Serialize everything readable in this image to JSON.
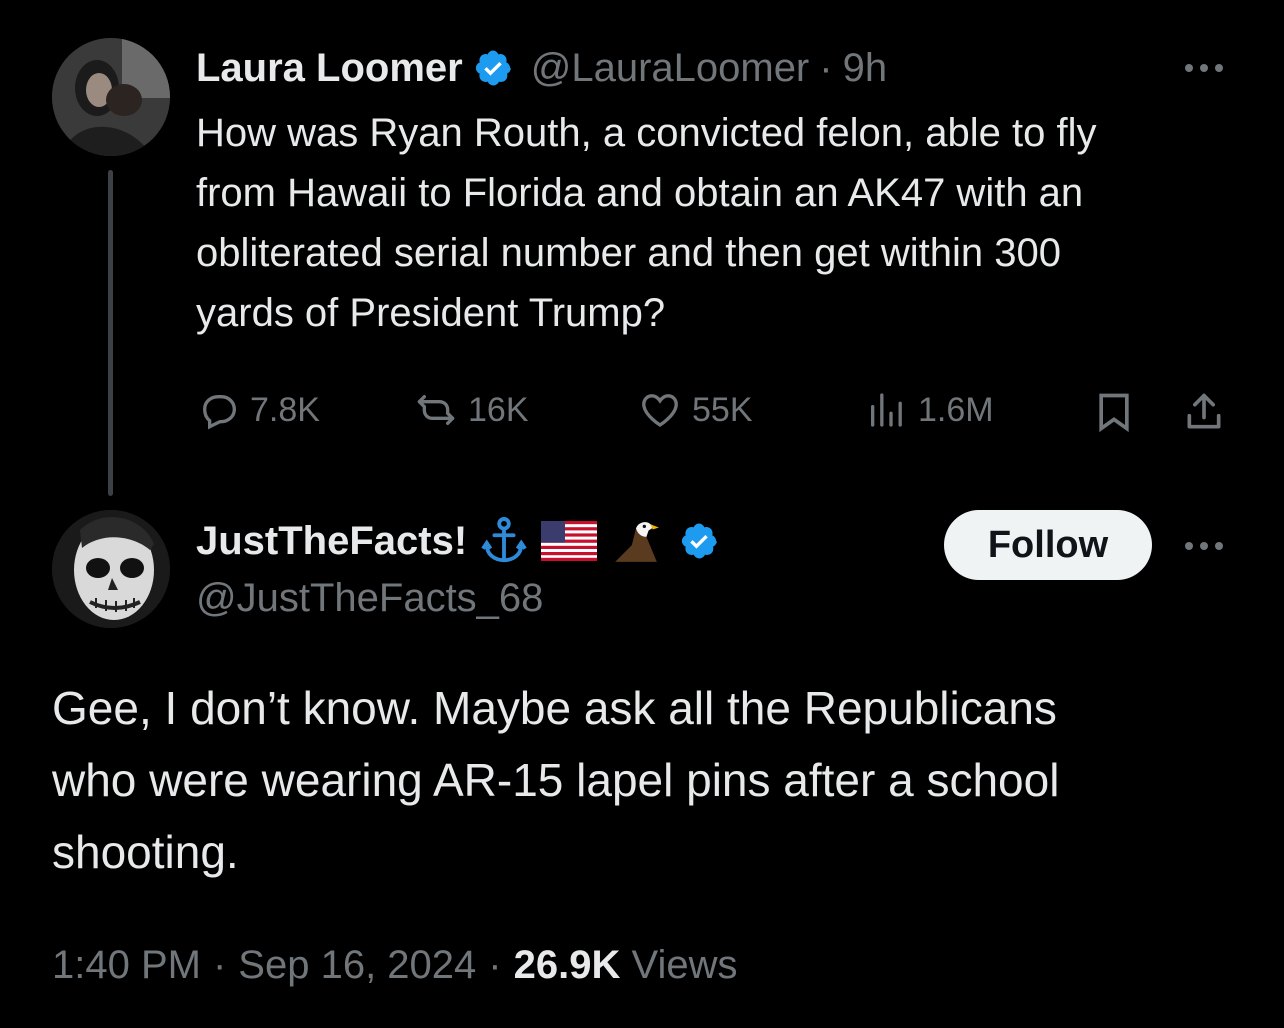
{
  "parent": {
    "name": "Laura Loomer",
    "handle": "@LauraLoomer",
    "separator": "·",
    "time": "9h",
    "text_lines": [
      "How was Ryan Routh, a convicted felon, able to fly",
      "from Hawaii to Florida and obtain an AK47 with an",
      "obliterated serial number and then get within 300",
      "yards of President Trump?"
    ],
    "stats": {
      "replies": "7.8K",
      "reposts": "16K",
      "likes": "55K",
      "views": "1.6M"
    }
  },
  "reply": {
    "name": "JustTheFacts!",
    "handle": "@JustTheFacts_68",
    "follow_label": "Follow",
    "text_lines": [
      "Gee, I don’t know. Maybe ask all the Republicans",
      "who were wearing AR-15 lapel pins after a school",
      "shooting."
    ],
    "meta": {
      "time": "1:40 PM",
      "sep1": "·",
      "date": "Sep 16, 2024",
      "sep2": "·",
      "views_count": "26.9K",
      "views_label": "Views"
    }
  },
  "icons": {
    "verified": "verified-badge-icon",
    "more": "more-options-icon",
    "reply": "reply-icon",
    "repost": "repost-icon",
    "like": "like-icon",
    "views": "views-icon",
    "bookmark": "bookmark-icon",
    "share": "share-icon",
    "anchor": "anchor-emoji",
    "flag": "us-flag-emoji",
    "eagle": "eagle-emoji"
  },
  "colors": {
    "background": "#000000",
    "text": "#e7e9ea",
    "secondary": "#71767b",
    "verified": "#1d9bf0",
    "follow_bg": "#eff3f4"
  }
}
